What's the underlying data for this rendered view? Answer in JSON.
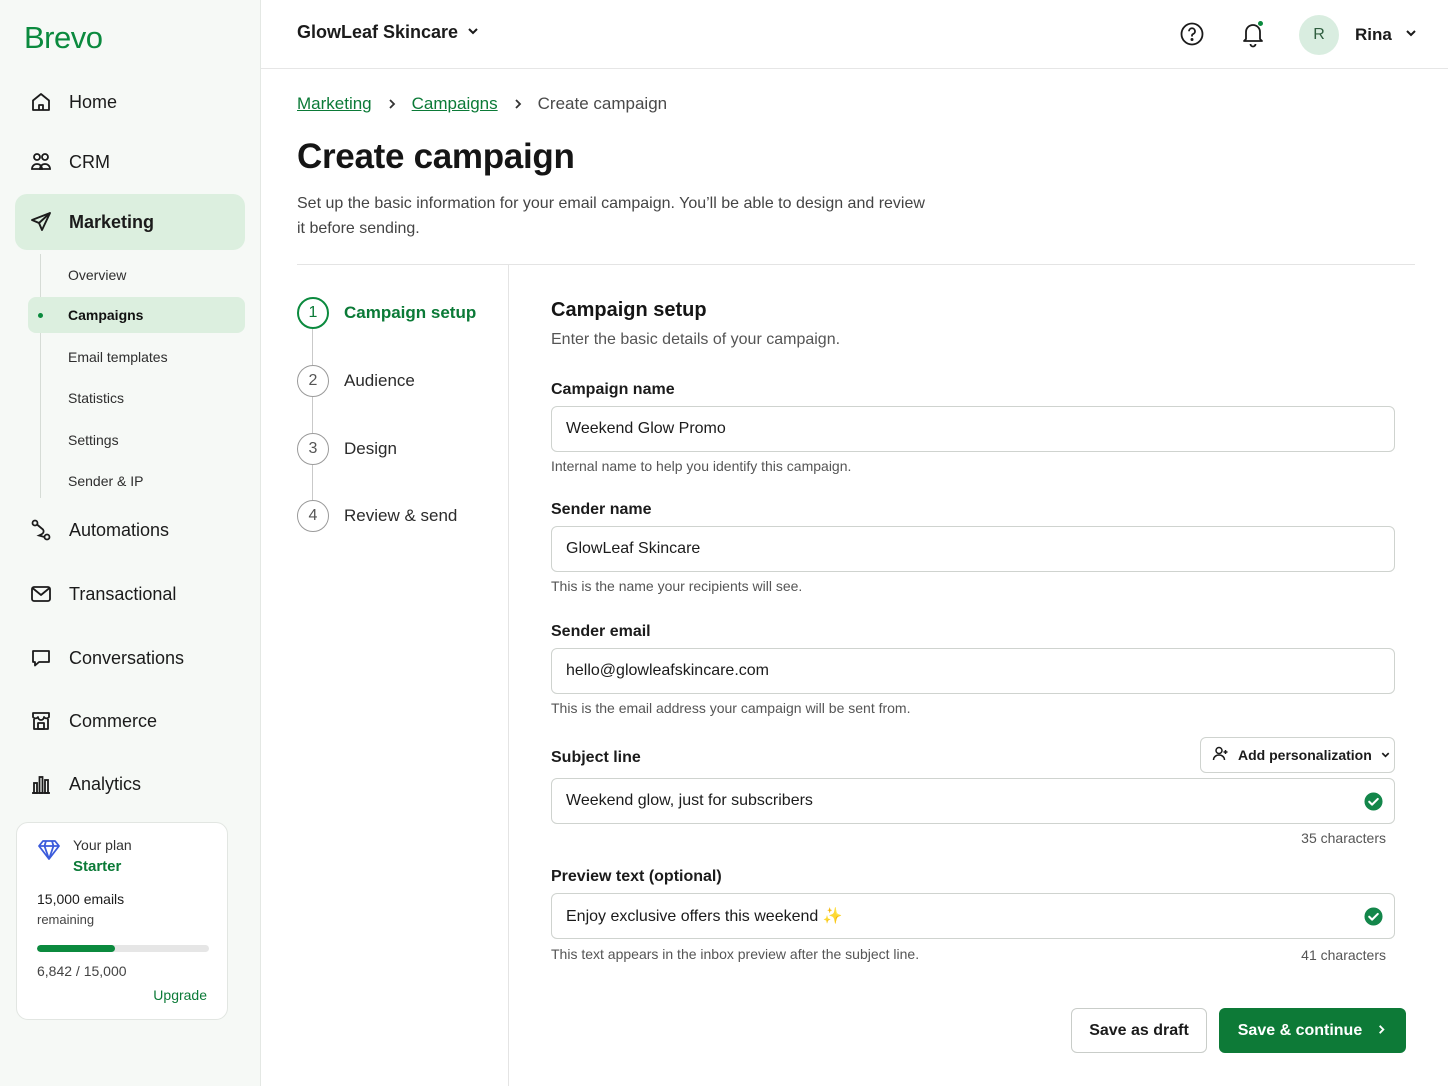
{
  "brand": {
    "logo": "Brevo",
    "accent": "#0b8a3e"
  },
  "sidebar": {
    "items": [
      {
        "label": "Home",
        "icon": "home-icon"
      },
      {
        "label": "CRM",
        "icon": "users-icon"
      },
      {
        "label": "Marketing",
        "icon": "send-icon"
      },
      {
        "label": "Automations",
        "icon": "route-icon"
      },
      {
        "label": "Transactional",
        "icon": "mail-icon"
      },
      {
        "label": "Conversations",
        "icon": "chat-icon"
      },
      {
        "label": "Commerce",
        "icon": "store-icon"
      },
      {
        "label": "Analytics",
        "icon": "bar-chart-icon"
      }
    ],
    "marketing_sub": [
      "Overview",
      "Campaigns",
      "Email templates",
      "Statistics",
      "Settings",
      "Sender & IP"
    ],
    "active_item": "Marketing",
    "active_sub": "Campaigns",
    "plan": {
      "label": "Your plan",
      "name": "Starter",
      "emails": "15,000 emails",
      "remaining": "remaining",
      "usage": "6,842 / 15,000",
      "usage_fraction": 0.456,
      "upgrade": "Upgrade"
    }
  },
  "topbar": {
    "org_name": "GlowLeaf Skincare",
    "avatar_initial": "R",
    "user_name": "Rina"
  },
  "breadcrumb": [
    "Marketing",
    "Campaigns",
    "Create campaign"
  ],
  "page": {
    "title": "Create campaign",
    "description": "Set up the basic information for your email campaign. You’ll be able to design and review it before sending."
  },
  "steps": [
    {
      "num": "1",
      "label": "Campaign setup",
      "active": true
    },
    {
      "num": "2",
      "label": "Audience"
    },
    {
      "num": "3",
      "label": "Design"
    },
    {
      "num": "4",
      "label": "Review & send"
    }
  ],
  "form": {
    "title": "Campaign setup",
    "description": "Enter the basic details of your campaign.",
    "campaign_name": {
      "label": "Campaign name",
      "value": "Weekend Glow Promo",
      "hint": "Internal name to help you identify this campaign."
    },
    "sender_name": {
      "label": "Sender name",
      "value": "GlowLeaf Skincare",
      "hint": "This is the name your recipients will see."
    },
    "sender_email": {
      "label": "Sender email",
      "value": "hello@glowleafskincare.com",
      "hint": "This is the email address your campaign will be sent from."
    },
    "subject": {
      "label": "Subject line",
      "value": "Weekend glow, just for subscribers",
      "counter": "35 characters",
      "personalization": "Add personalization"
    },
    "preview": {
      "label": "Preview text (optional)",
      "value": "Enjoy exclusive offers this weekend ✨",
      "hint": "This text appears in the inbox preview after the subject line.",
      "counter": "41 characters"
    }
  },
  "actions": {
    "draft": "Save as draft",
    "continue": "Save & continue"
  }
}
